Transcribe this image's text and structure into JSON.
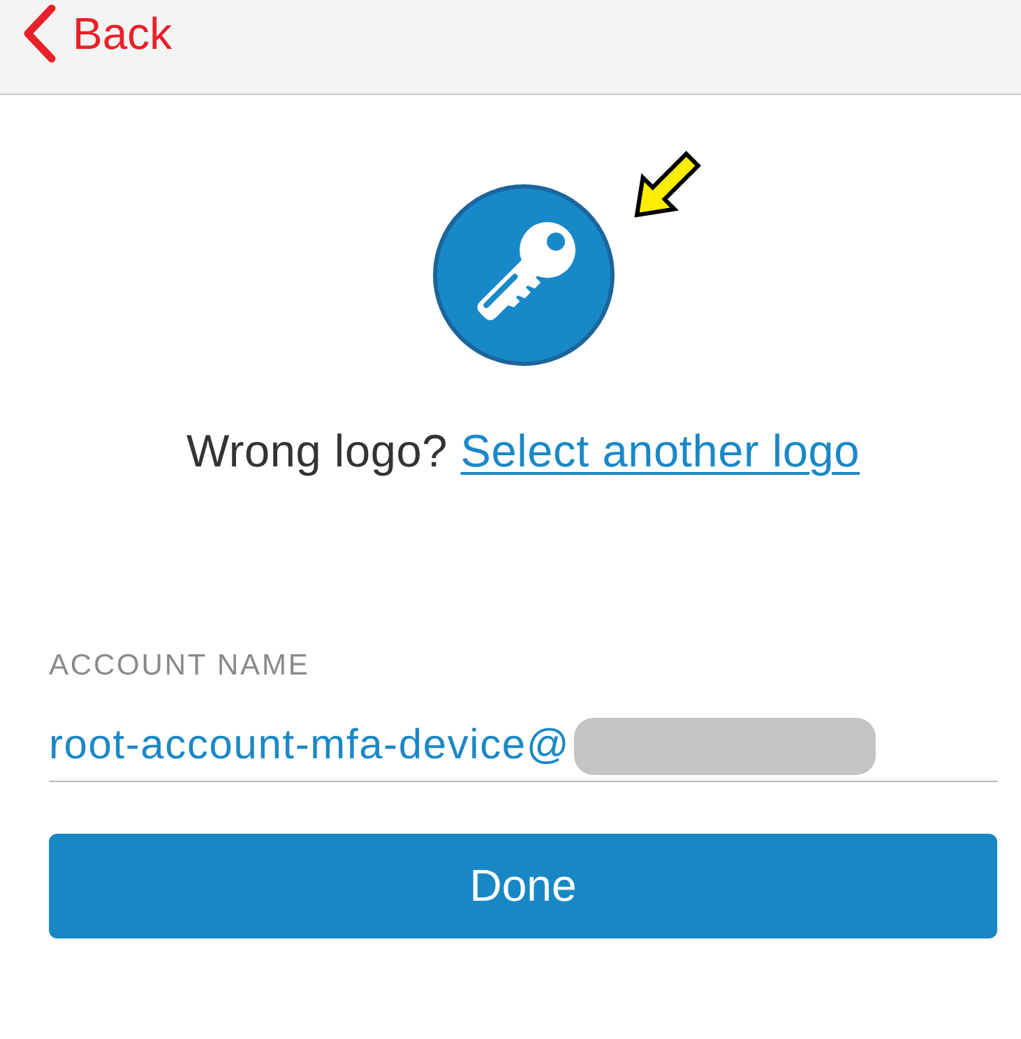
{
  "nav": {
    "back_label": "Back"
  },
  "logo_prompt": {
    "text": "Wrong logo?",
    "link": "Select another logo"
  },
  "account_name": {
    "label": "ACCOUNT NAME",
    "value": "root-account-mfa-device@",
    "redacted": true
  },
  "done_button": "Done"
}
